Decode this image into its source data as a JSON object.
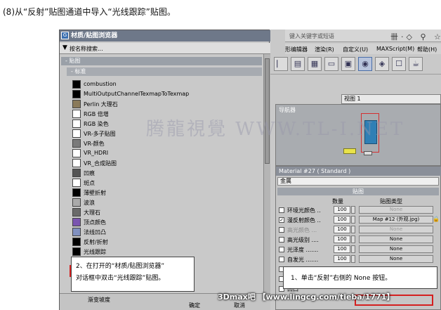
{
  "caption": "(8)从“反射”贴图通道中导入“光线跟踪”贴图。",
  "max": {
    "search_text": "键入关键字或短语",
    "top_icons": "卌·◇ ⚲ ☆ | ? ·",
    "menus": [
      "形编辑器",
      "渲染(R)",
      "自定义(U)",
      "MAXScript(M)",
      "帮助(H)"
    ],
    "view_select": "视图 1",
    "nav_title": "导航器",
    "material": {
      "title": "Material #27  ( Standard )",
      "name": "金属",
      "maps_header": "贴图",
      "col_amount": "数量",
      "col_maptype": "贴图类型",
      "rows": [
        {
          "label": "环境光颜色 ..",
          "amount": "100",
          "map": "None",
          "checked": false,
          "disabled_label": false,
          "disabled_map": true
        },
        {
          "label": "漫反射颜色 ..",
          "amount": "100",
          "map": "Map #12 (外观.jpg)",
          "checked": true,
          "disabled_label": false,
          "disabled_map": false
        },
        {
          "label": "高光颜色 ...",
          "amount": "100",
          "map": "None",
          "checked": false,
          "disabled_label": true,
          "disabled_map": true
        },
        {
          "label": "高光级别 ....",
          "amount": "100",
          "map": "None",
          "checked": false,
          "disabled_label": false,
          "disabled_map": false
        },
        {
          "label": "光泽度 .......",
          "amount": "100",
          "map": "None",
          "checked": false,
          "disabled_label": false,
          "disabled_map": false
        },
        {
          "label": "自发光 .......",
          "amount": "100",
          "map": "None",
          "checked": false,
          "disabled_label": false,
          "disabled_map": false
        },
        {
          "label": "不透",
          "amount": "",
          "map": "",
          "checked": false,
          "disabled_label": false,
          "disabled_map": false
        },
        {
          "label": "过滤",
          "amount": "",
          "map": "",
          "checked": false,
          "disabled_label": false,
          "disabled_map": false
        },
        {
          "label": "凹凸",
          "amount": "",
          "map": "",
          "checked": false,
          "disabled_label": false,
          "disabled_map": false
        }
      ]
    }
  },
  "browser": {
    "title": "材质/贴图浏览器",
    "search": "按名称搜索...",
    "group_maps": "- 贴图",
    "group_std": "- 标准",
    "items": [
      {
        "label": "combustion",
        "color": "#000000"
      },
      {
        "label": "MultiOutputChannelTexmapToTexmap",
        "color": "#000000"
      },
      {
        "label": "Perlin 大理石",
        "color": "#8a7a5a"
      },
      {
        "label": "RGB 倍增",
        "color": "#ffffff"
      },
      {
        "label": "RGB 染色",
        "color": "#ffffff"
      },
      {
        "label": "VR-多子贴图",
        "color": "#ffffff"
      },
      {
        "label": "VR-颜色",
        "color": "#7a7a7a"
      },
      {
        "label": "VR_HDRI",
        "color": "#ffffff"
      },
      {
        "label": "VR_合成贴图",
        "color": "#ffffff"
      },
      {
        "label": "凹痕",
        "color": "#555555"
      },
      {
        "label": "斑点",
        "color": "#ffffff"
      },
      {
        "label": "薄壁折射",
        "color": "#000000"
      },
      {
        "label": "波浪",
        "color": "#aaaaaa"
      },
      {
        "label": "大理石",
        "color": "#6a6a6a"
      },
      {
        "label": "顶点颜色",
        "color": "#7a55b0"
      },
      {
        "label": "法线凹凸",
        "color": "#8090c0"
      },
      {
        "label": "反射/折射",
        "color": "#000000"
      },
      {
        "label": "光线跟踪",
        "color": "#000000"
      },
      {
        "label": "",
        "color": "#000000"
      }
    ],
    "ok": "确定",
    "cancel": "取消",
    "partial_item": "渐变坡度"
  },
  "callout1": {
    "line1": "2、在打开的“材质/贴图浏览器”",
    "line2": "对话框中双击“光线跟踪”贴图。"
  },
  "callout2": "1、单击“反射”右侧的 None 按钮。",
  "watermark": "腾龍視覺 WWW.TL-I.NET",
  "brand": "3Dmax吧 【www.lingcg.com/tieba/1771】"
}
